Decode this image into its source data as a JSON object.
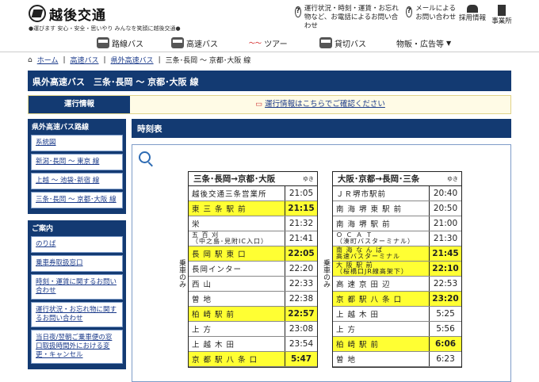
{
  "header": {
    "logo": "越後交通",
    "slogan": "●運びます 安心・安全・思いやり みんなを笑顔に越後交通●",
    "links": [
      {
        "icon": "question-icon",
        "text": "運行状況・時刻・運賃・お忘れ物など、お電話によるお問い合わせ"
      },
      {
        "icon": "mail-icon",
        "text": "メールによるお問い合わせ"
      },
      {
        "icon": "people-icon",
        "text": "採用情報"
      },
      {
        "icon": "building-icon",
        "text": "事業所"
      }
    ]
  },
  "nav": [
    "路線バス",
    "高速バス",
    "ツアー",
    "貸切バス",
    "物販・広告等"
  ],
  "breadcrumb": [
    "ホーム",
    "高速バス",
    "県外高速バス",
    "三条･長岡 〜 京都･大阪 線"
  ],
  "page_title": "県外高速バス　三条･長岡 〜 京都･大阪 線",
  "info": {
    "label": "運行情報",
    "link": "運行情報はこちらでご確認ください"
  },
  "sidebar": {
    "routes_title": "県外高速バス路線",
    "routes": [
      "系統図",
      "新潟･長岡 〜 東京 線",
      "上越 〜 池袋･新宿 線",
      "三条･長岡 〜 京都･大阪 線"
    ],
    "guide_title": "ご案内",
    "guide": [
      "のりば",
      "乗車券取扱窓口",
      "時刻・運賃に関するお問い合わせ",
      "運行状況・お忘れ物に関するお問い合わせ",
      "当日夜/翌朝ご乗車便の窓口取扱時間外における変更・キャンセル"
    ]
  },
  "timetable": {
    "title": "時刻表",
    "yuki": "ゆき",
    "side_note": "乗車のみ",
    "left": {
      "title": "三条･長岡→京都･大阪",
      "rows": [
        {
          "stop": "越後交通三条営業所",
          "time": "21:05"
        },
        {
          "stop": "東 三 条 駅 前",
          "time": "21:15"
        },
        {
          "stop": "栄",
          "time": "21:32"
        },
        {
          "stop": "五 百 刈",
          "stop2": "（中之島･見附IC入口）",
          "time": "21:41"
        },
        {
          "stop": "長 岡 駅 東 口",
          "time": "22:05"
        },
        {
          "stop": "長岡インター",
          "time": "22:20"
        },
        {
          "stop": "西 山",
          "time": "22:33"
        },
        {
          "stop": "曽 地",
          "time": "22:38"
        },
        {
          "stop": "柏 崎 駅 前",
          "time": "22:57"
        },
        {
          "stop": "上 方",
          "time": "23:08"
        },
        {
          "stop": "上 越 木 田",
          "time": "23:54"
        },
        {
          "stop": "京 都 駅 八 条 口",
          "time": "5:47"
        }
      ]
    },
    "right": {
      "title": "大阪･京都→長岡･三条",
      "rows": [
        {
          "stop": "ＪＲ堺市駅前",
          "time": "20:40"
        },
        {
          "stop": "南 海 堺 東 駅 前",
          "time": "20:50"
        },
        {
          "stop": "南 海 堺 駅 前",
          "time": "21:00"
        },
        {
          "stop": "Ｏ Ｃ Ａ Ｔ",
          "stop2": "（湊町バスターミナル）",
          "time": "21:30"
        },
        {
          "stop": "南 海 な ん ば",
          "stop2": "高速バスターミナル",
          "time": "21:45"
        },
        {
          "stop": "大 阪 駅 前",
          "stop2": "（桜橋口JR線高架下）",
          "time": "22:10"
        },
        {
          "stop": "高 速 京 田 辺",
          "time": "22:53"
        },
        {
          "stop": "京 都 駅 八 条 口",
          "time": "23:20"
        },
        {
          "stop": "上 越 木 田",
          "time": "5:25"
        },
        {
          "stop": "上 方",
          "time": "5:56"
        },
        {
          "stop": "柏 崎 駅 前",
          "time": "6:06"
        },
        {
          "stop": "曽 地",
          "time": "6:23"
        }
      ]
    }
  }
}
